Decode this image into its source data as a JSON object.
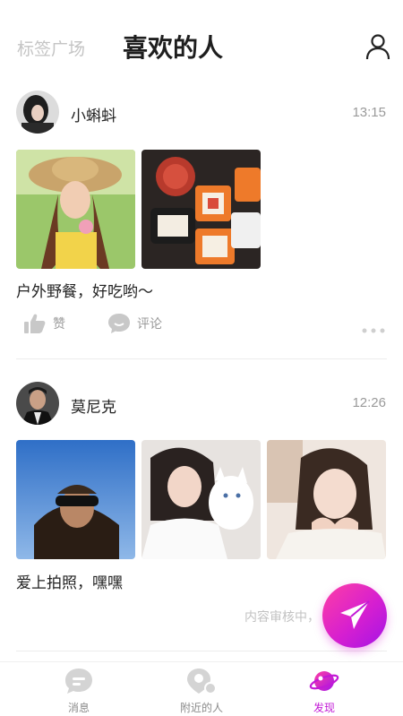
{
  "header": {
    "tab_tags": "标签广场",
    "tab_liked": "喜欢的人",
    "profile_icon": "user-icon"
  },
  "posts": [
    {
      "username": "小蝌蚪",
      "time": "13:15",
      "caption": "户外野餐，好吃哟～",
      "like_label": "赞",
      "comment_label": "评论"
    },
    {
      "username": "莫尼克",
      "time": "12:26",
      "caption": "爱上拍照，嘿嘿",
      "review_status": "内容审核中，"
    }
  ],
  "tabbar": {
    "items": [
      {
        "label": "消息",
        "icon": "message-icon"
      },
      {
        "label": "附近的人",
        "icon": "location-icon"
      },
      {
        "label": "发现",
        "icon": "planet-icon"
      }
    ],
    "active_color": "#c21ad6",
    "inactive_color": "#8a8a8a"
  },
  "colors": {
    "fab_gradient_start": "#ff3fa4",
    "fab_gradient_end": "#a414e6"
  }
}
